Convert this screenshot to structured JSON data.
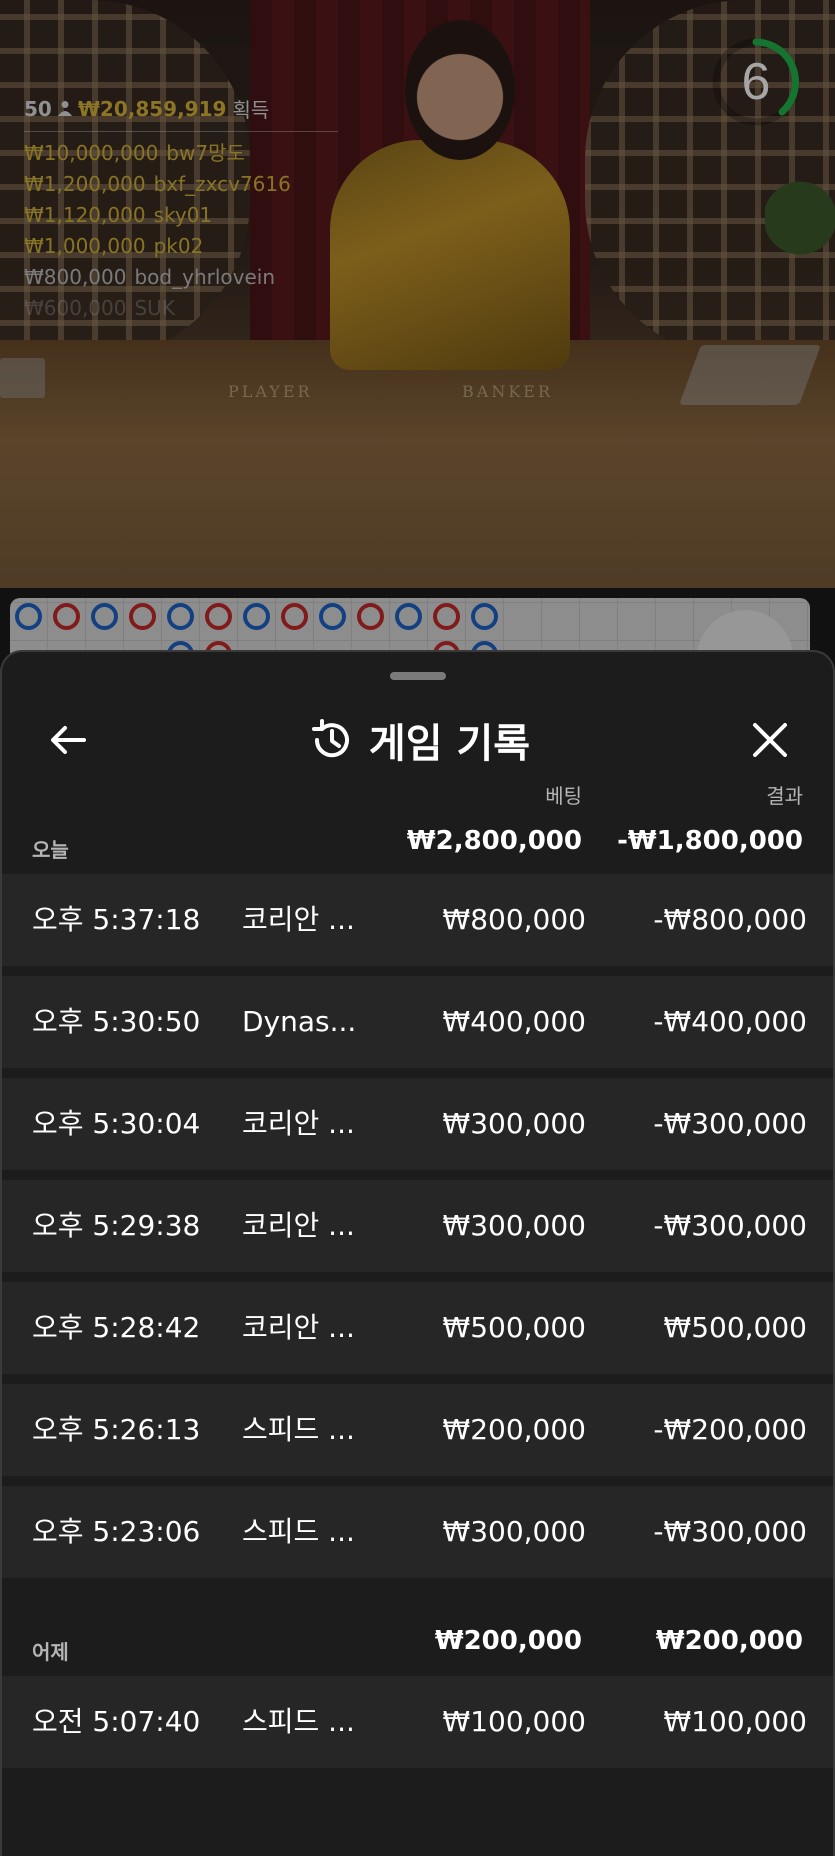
{
  "video": {
    "felt_player": "PLAYER",
    "felt_banker": "BANKER",
    "timer": "6",
    "winners_header": {
      "count": "50",
      "total": "₩20,859,919",
      "gain_label": "획득"
    },
    "winners": [
      {
        "amount": "₩10,000,000",
        "name": "bw7망도"
      },
      {
        "amount": "₩1,200,000",
        "name": "bxf_zxcv7616"
      },
      {
        "amount": "₩1,120,000",
        "name": "sky01"
      },
      {
        "amount": "₩1,000,000",
        "name": "pk02"
      },
      {
        "amount": "₩800,000",
        "name": "bod_yhrlovein"
      },
      {
        "amount": "₩600,000",
        "name": "SUK"
      }
    ]
  },
  "roadmap": {
    "row1": [
      "P",
      "B",
      "P",
      "B",
      "P",
      "B",
      "P",
      "B",
      "P",
      "B",
      "P",
      "B",
      "P"
    ],
    "row2": [
      "",
      "",
      "",
      "",
      "P",
      "B",
      "",
      "",
      "",
      "",
      "",
      "B",
      "P"
    ]
  },
  "sheet": {
    "title": "게임 기록",
    "col_bet": "베팅",
    "col_result": "결과",
    "sections": [
      {
        "label": "오늘",
        "bet_total": "₩2,800,000",
        "result_total": "-₩1,800,000",
        "rows": [
          {
            "time": "오후 5:37:18",
            "game": "코리안 ...",
            "bet": "₩800,000",
            "result": "-₩800,000"
          },
          {
            "time": "오후 5:30:50",
            "game": "Dynas...",
            "bet": "₩400,000",
            "result": "-₩400,000"
          },
          {
            "time": "오후 5:30:04",
            "game": "코리안 ...",
            "bet": "₩300,000",
            "result": "-₩300,000"
          },
          {
            "time": "오후 5:29:38",
            "game": "코리안 ...",
            "bet": "₩300,000",
            "result": "-₩300,000"
          },
          {
            "time": "오후 5:28:42",
            "game": "코리안 ...",
            "bet": "₩500,000",
            "result": "₩500,000"
          },
          {
            "time": "오후 5:26:13",
            "game": "스피드 ...",
            "bet": "₩200,000",
            "result": "-₩200,000"
          },
          {
            "time": "오후 5:23:06",
            "game": "스피드 ...",
            "bet": "₩300,000",
            "result": "-₩300,000"
          }
        ]
      },
      {
        "label": "어제",
        "bet_total": "₩200,000",
        "result_total": "₩200,000",
        "rows": [
          {
            "time": "오전 5:07:40",
            "game": "스피드 ...",
            "bet": "₩100,000",
            "result": "₩100,000"
          }
        ]
      }
    ]
  },
  "colors": {
    "sheet_bg": "#1c1c1c",
    "row_bg": "#262626",
    "winner_gold": "#d2b23a",
    "timer_green": "#1fb34a",
    "bead_player": "#1e63c6",
    "bead_banker": "#c62828"
  }
}
